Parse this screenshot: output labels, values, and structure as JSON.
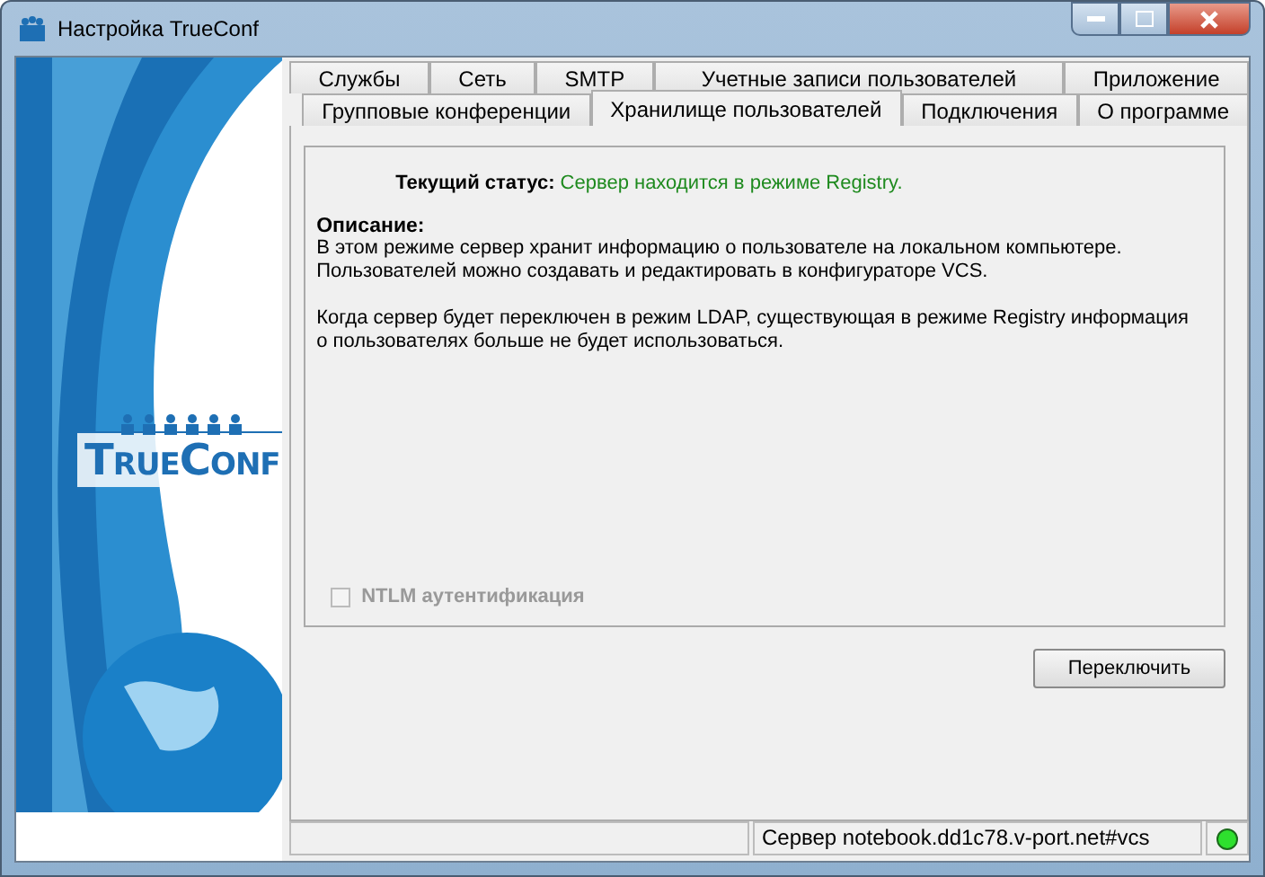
{
  "window": {
    "title": "Настройка TrueConf"
  },
  "logo": {
    "text": "TrueConf"
  },
  "tab_rows": [
    [
      {
        "label": "Службы",
        "selected": false
      },
      {
        "label": "Сеть",
        "selected": false
      },
      {
        "label": "SMTP",
        "selected": false
      },
      {
        "label": "Учетные записи пользователей",
        "selected": false
      },
      {
        "label": "Приложение",
        "selected": false
      }
    ],
    [
      {
        "label": "Групповые конференции",
        "selected": false
      },
      {
        "label": "Хранилище пользователей",
        "selected": true
      },
      {
        "label": "Подключения",
        "selected": false
      },
      {
        "label": "О программе",
        "selected": false
      }
    ]
  ],
  "status": {
    "label": "Текущий статус:",
    "value": "Сервер находится в режиме Registry."
  },
  "description": {
    "heading": "Описание:",
    "paragraphs": [
      "В этом режиме сервер хранит информацию о пользователе на локальном компьютере. Пользователей можно создавать и редактировать в конфигураторе VCS.",
      "Когда сервер будет переключен в режим LDAP, существующая в режиме Registry информация о пользователях больше не будет использоваться."
    ]
  },
  "ntlm_checkbox": {
    "label": "NTLM аутентификация",
    "checked": false,
    "disabled": true
  },
  "switch_button": {
    "label": "Переключить"
  },
  "status_bar": {
    "server": "Сервер notebook.dd1c78.v-port.net#vcs",
    "connected": true
  }
}
